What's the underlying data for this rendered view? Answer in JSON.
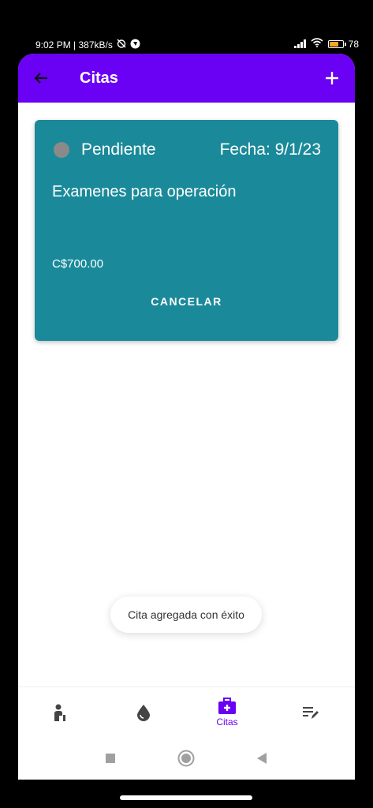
{
  "status_bar": {
    "time_speed": "9:02 PM | 387kB/s",
    "battery": "78",
    "battery_level": 0.78,
    "icons": [
      "alarm-off-icon",
      "app-notification-icon",
      "signal-icon",
      "wifi-icon",
      "battery-icon"
    ]
  },
  "app_bar": {
    "title": "Citas",
    "back_icon": "arrow-back-icon",
    "add_icon": "plus-icon"
  },
  "appointment": {
    "status": "Pendiente",
    "date": "Fecha: 9/1/23",
    "description": "Examenes para operación",
    "price": "C$700.00",
    "cancel_label": "CANCELAR",
    "card_color": "#1a8a9a",
    "status_dot_color": "#8a8a8a"
  },
  "toast": {
    "message": "Cita agregada con éxito"
  },
  "bottom_nav": {
    "items": [
      {
        "icon": "patient-icon",
        "label": ""
      },
      {
        "icon": "blood-drop-icon",
        "label": ""
      },
      {
        "icon": "medical-bag-icon",
        "label": "Citas",
        "active": true
      },
      {
        "icon": "edit-list-icon",
        "label": ""
      }
    ],
    "active_color": "#6a00f4"
  },
  "system_nav": {
    "icons": [
      "recents-square-icon",
      "home-circle-icon",
      "back-triangle-icon"
    ]
  },
  "colors": {
    "primary": "#6a00f4",
    "background": "#ffffff"
  }
}
